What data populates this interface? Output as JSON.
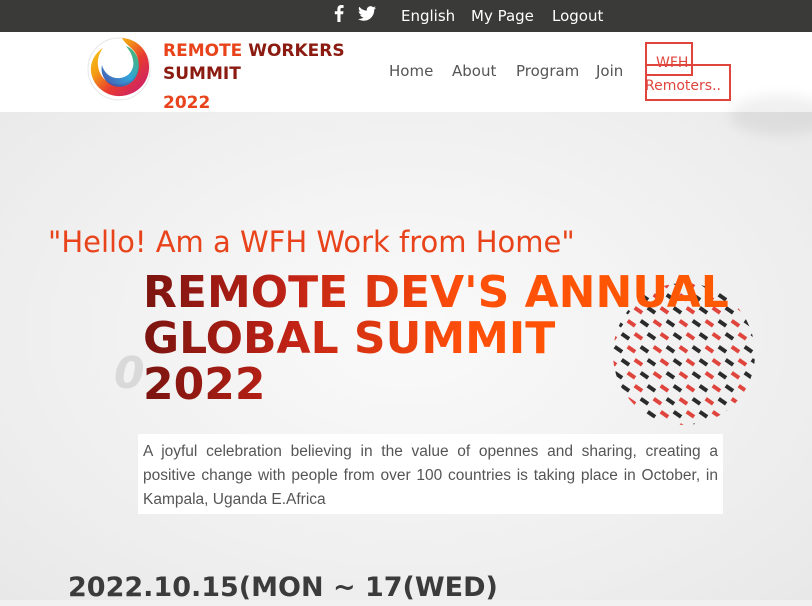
{
  "topbar": {
    "icons": [
      "facebook-icon",
      "twitter-icon"
    ],
    "links": [
      "English",
      "My Page",
      "Logout"
    ]
  },
  "brand": {
    "line1_a": "REMOTE",
    "line1_b": "WORKERS",
    "line2": "SUMMIT",
    "year": "2022"
  },
  "nav": {
    "items": [
      "Home",
      "About",
      "Program",
      "Join"
    ],
    "cta_line1": "WFH",
    "cta_line2": "Remoters.."
  },
  "hero": {
    "greeting": "\"Hello! Am a WFH Work from Home\"",
    "headline_line1": "REMOTE DEV'S ANNUAL",
    "headline_line2": "GLOBAL  SUMMIT",
    "headline_line3": "2022",
    "description": "A joyful celebration believing in the value of opennes and sharing, creating a positive change with people from over 100 countries is taking place in October, in Kampala, Uganda E.Africa",
    "date": "2022.10.15(MON ~ 17(WED)"
  },
  "colors": {
    "accent": "#e8431a",
    "dark_red": "#8b1a10",
    "topbar": "#3a3a38",
    "cta_border": "#e0453d"
  }
}
